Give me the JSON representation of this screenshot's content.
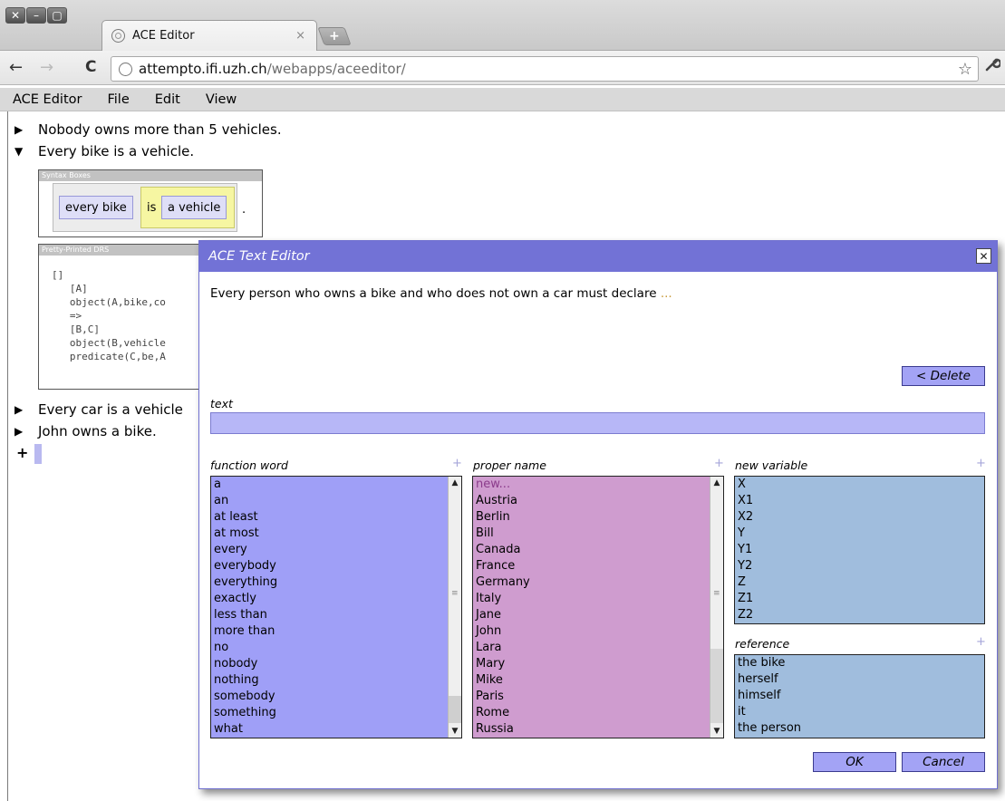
{
  "browser": {
    "tab_title": "ACE Editor",
    "tab_close": "×",
    "new_tab": "+",
    "url_host": "attempto.ifi.uzh.ch",
    "url_path": "/webapps/aceeditor/",
    "back": "←",
    "forward": "→",
    "reload": "C",
    "bookmark": "☆",
    "wrench": "🔧"
  },
  "menu": [
    "ACE Editor",
    "File",
    "Edit",
    "View"
  ],
  "document": {
    "sentences": [
      {
        "text": "Nobody owns more than 5 vehicles.",
        "expanded": false
      },
      {
        "text": "Every bike is a vehicle.",
        "expanded": true
      },
      {
        "text": "Every car is a vehicle",
        "expanded": false
      },
      {
        "text": "John owns a bike.",
        "expanded": false
      }
    ],
    "add_symbol": "+",
    "syntax_panel": {
      "title": "Syntax Boxes",
      "np": "every bike",
      "verb": "is",
      "obj": "a vehicle",
      "period": "."
    },
    "drs_panel": {
      "title": "Pretty-Printed DRS",
      "lines": [
        "[]",
        "   [A]",
        "   object(A,bike,co",
        "   =>",
        "   [B,C]",
        "   object(B,vehicle",
        "   predicate(C,be,A"
      ]
    }
  },
  "dialog": {
    "title": "ACE Text Editor",
    "close": "✕",
    "sentence": "Every person who owns a bike and who does not own a car must declare",
    "ellipsis": "...",
    "delete_label": "< Delete",
    "text_label": "text",
    "text_value": "",
    "ok_label": "OK",
    "cancel_label": "Cancel",
    "plus": "+",
    "lists": {
      "function_word": {
        "label": "function word",
        "items": [
          "a",
          "an",
          "at least",
          "at most",
          "every",
          "everybody",
          "everything",
          "exactly",
          "less than",
          "more than",
          "no",
          "nobody",
          "nothing",
          "somebody",
          "something",
          "what"
        ]
      },
      "proper_name": {
        "label": "proper name",
        "items": [
          "new...",
          "Austria",
          "Berlin",
          "Bill",
          "Canada",
          "France",
          "Germany",
          "Italy",
          "Jane",
          "John",
          "Lara",
          "Mary",
          "Mike",
          "Paris",
          "Rome",
          "Russia"
        ]
      },
      "new_variable": {
        "label": "new variable",
        "items": [
          "X",
          "X1",
          "X2",
          "Y",
          "Y1",
          "Y2",
          "Z",
          "Z1",
          "Z2"
        ]
      },
      "reference": {
        "label": "reference",
        "items": [
          "the bike",
          "herself",
          "himself",
          "it",
          "the person"
        ]
      }
    }
  },
  "colors": {
    "function_word_bg": "#9f9ff7",
    "proper_name_bg": "#cf9ccf",
    "variable_bg": "#a0bddd",
    "dialog_title_bg": "#7272d6"
  }
}
